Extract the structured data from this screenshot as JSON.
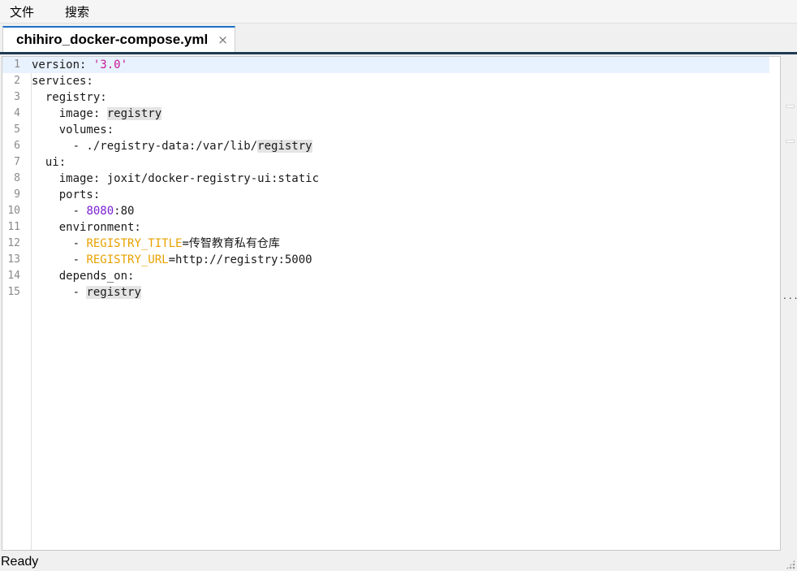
{
  "menubar": {
    "items": [
      "文件",
      "搜索"
    ]
  },
  "tab": {
    "title": "chihiro_docker-compose.yml",
    "close_glyph": "×"
  },
  "editor": {
    "current_line": 1,
    "lines": [
      {
        "n": "1",
        "parts": [
          {
            "t": "version: "
          },
          {
            "t": "'3.0'",
            "c": "str"
          }
        ]
      },
      {
        "n": "2",
        "parts": [
          {
            "t": "services:"
          }
        ]
      },
      {
        "n": "3",
        "parts": [
          {
            "t": "  registry:"
          }
        ]
      },
      {
        "n": "4",
        "parts": [
          {
            "t": "    image: "
          },
          {
            "t": "registry",
            "c": "hl"
          }
        ]
      },
      {
        "n": "5",
        "parts": [
          {
            "t": "    volumes:"
          }
        ]
      },
      {
        "n": "6",
        "parts": [
          {
            "t": "      - ./registry-data:/var/lib/"
          },
          {
            "t": "registry",
            "c": "hl"
          }
        ]
      },
      {
        "n": "7",
        "parts": [
          {
            "t": "  ui:"
          }
        ]
      },
      {
        "n": "8",
        "parts": [
          {
            "t": "    image: joxit/docker-registry-ui:static"
          }
        ]
      },
      {
        "n": "9",
        "parts": [
          {
            "t": "    ports:"
          }
        ]
      },
      {
        "n": "10",
        "parts": [
          {
            "t": "      - "
          },
          {
            "t": "8080",
            "c": "num"
          },
          {
            "t": ":80"
          }
        ]
      },
      {
        "n": "11",
        "parts": [
          {
            "t": "    environment:"
          }
        ]
      },
      {
        "n": "12",
        "parts": [
          {
            "t": "      - "
          },
          {
            "t": "REGISTRY_TITLE",
            "c": "env"
          },
          {
            "t": "="
          },
          {
            "t": "传智教育私有仓库",
            "c": "cjk"
          }
        ]
      },
      {
        "n": "13",
        "parts": [
          {
            "t": "      - "
          },
          {
            "t": "REGISTRY_URL",
            "c": "env"
          },
          {
            "t": "=http://registry:5000"
          }
        ]
      },
      {
        "n": "14",
        "parts": [
          {
            "t": "    depends_on:"
          }
        ]
      },
      {
        "n": "15",
        "parts": [
          {
            "t": "      - "
          },
          {
            "t": "registry",
            "c": "hl"
          }
        ]
      }
    ]
  },
  "scrollbar": {
    "overview_glyph": "..."
  },
  "status": {
    "text": "Ready"
  },
  "colors": {
    "tab_accent": "#1e6fc4",
    "string": "#c8189b",
    "number": "#7a1fd1",
    "env_key": "#e8a100",
    "current_line": "#e8f2fe"
  }
}
